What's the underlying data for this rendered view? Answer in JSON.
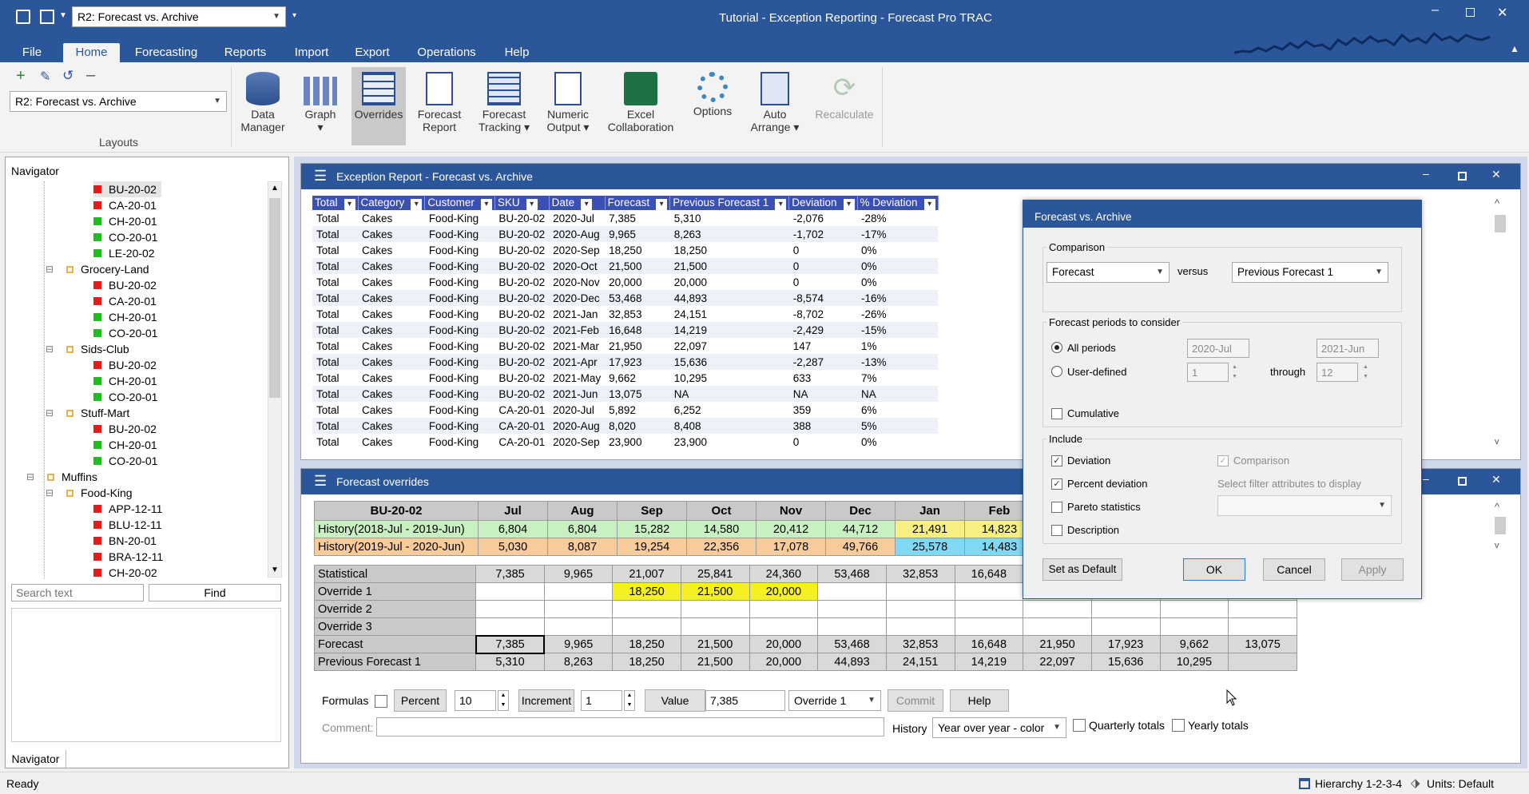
{
  "app": {
    "title": "Tutorial - Exception Reporting - Forecast Pro TRAC",
    "layout_select": "R2: Forecast vs. Archive"
  },
  "menu": [
    "File",
    "Home",
    "Forecasting",
    "Reports",
    "Import",
    "Export",
    "Operations",
    "Help"
  ],
  "ribbon": {
    "layouts_label": "Layouts",
    "layout_value": "R2: Forecast vs. Archive",
    "buttons": [
      {
        "l1": "Data",
        "l2": "Manager"
      },
      {
        "l1": "Graph",
        "l2": "▾"
      },
      {
        "l1": "Overrides",
        "l2": ""
      },
      {
        "l1": "Forecast",
        "l2": "Report"
      },
      {
        "l1": "Forecast",
        "l2": "Tracking ▾"
      },
      {
        "l1": "Numeric",
        "l2": "Output ▾"
      },
      {
        "l1": "Excel",
        "l2": "Collaboration"
      },
      {
        "l1": "Options",
        "l2": ""
      },
      {
        "l1": "Auto",
        "l2": "Arrange ▾"
      },
      {
        "l1": "Recalculate",
        "l2": ""
      }
    ]
  },
  "navigator": {
    "title": "Navigator",
    "search_placeholder": "Search text",
    "find": "Find",
    "tab": "Navigator",
    "items": [
      {
        "t": "BU-20-02",
        "lvl": 3,
        "c": "#e31b1b"
      },
      {
        "t": "CA-20-01",
        "lvl": 3,
        "c": "#e31b1b"
      },
      {
        "t": "CH-20-01",
        "lvl": 3,
        "c": "#22bb22"
      },
      {
        "t": "CO-20-01",
        "lvl": 3,
        "c": "#22bb22"
      },
      {
        "t": "LE-20-02",
        "lvl": 3,
        "c": "#22bb22"
      },
      {
        "t": "Grocery-Land",
        "lvl": 2,
        "c": "#e8b44a"
      },
      {
        "t": "BU-20-02",
        "lvl": 3,
        "c": "#e31b1b"
      },
      {
        "t": "CA-20-01",
        "lvl": 3,
        "c": "#e31b1b"
      },
      {
        "t": "CH-20-01",
        "lvl": 3,
        "c": "#22bb22"
      },
      {
        "t": "CO-20-01",
        "lvl": 3,
        "c": "#22bb22"
      },
      {
        "t": "Sids-Club",
        "lvl": 2,
        "c": "#e8b44a"
      },
      {
        "t": "BU-20-02",
        "lvl": 3,
        "c": "#e31b1b"
      },
      {
        "t": "CH-20-01",
        "lvl": 3,
        "c": "#22bb22"
      },
      {
        "t": "CO-20-01",
        "lvl": 3,
        "c": "#22bb22"
      },
      {
        "t": "Stuff-Mart",
        "lvl": 2,
        "c": "#e8b44a"
      },
      {
        "t": "BU-20-02",
        "lvl": 3,
        "c": "#e31b1b"
      },
      {
        "t": "CH-20-01",
        "lvl": 3,
        "c": "#22bb22"
      },
      {
        "t": "CO-20-01",
        "lvl": 3,
        "c": "#22bb22"
      },
      {
        "t": "Muffins",
        "lvl": 1,
        "c": "#e8b44a"
      },
      {
        "t": "Food-King",
        "lvl": 2,
        "c": "#e8b44a"
      },
      {
        "t": "APP-12-11",
        "lvl": 3,
        "c": "#e31b1b"
      },
      {
        "t": "BLU-12-11",
        "lvl": 3,
        "c": "#e31b1b"
      },
      {
        "t": "BN-20-01",
        "lvl": 3,
        "c": "#e31b1b"
      },
      {
        "t": "BRA-12-11",
        "lvl": 3,
        "c": "#e31b1b"
      },
      {
        "t": "CH-20-02",
        "lvl": 3,
        "c": "#e31b1b"
      }
    ]
  },
  "exception": {
    "title": "Exception Report - Forecast vs. Archive",
    "columns": [
      "Total",
      "Category",
      "Customer",
      "SKU",
      "Date",
      "Forecast",
      "Previous Forecast 1",
      "Deviation",
      "% Deviation"
    ],
    "rows": [
      [
        "Total",
        "Cakes",
        "Food-King",
        "BU-20-02",
        "2020-Jul",
        "7,385",
        "5,310",
        "-2,076",
        "-28%"
      ],
      [
        "Total",
        "Cakes",
        "Food-King",
        "BU-20-02",
        "2020-Aug",
        "9,965",
        "8,263",
        "-1,702",
        "-17%"
      ],
      [
        "Total",
        "Cakes",
        "Food-King",
        "BU-20-02",
        "2020-Sep",
        "18,250",
        "18,250",
        "0",
        "0%"
      ],
      [
        "Total",
        "Cakes",
        "Food-King",
        "BU-20-02",
        "2020-Oct",
        "21,500",
        "21,500",
        "0",
        "0%"
      ],
      [
        "Total",
        "Cakes",
        "Food-King",
        "BU-20-02",
        "2020-Nov",
        "20,000",
        "20,000",
        "0",
        "0%"
      ],
      [
        "Total",
        "Cakes",
        "Food-King",
        "BU-20-02",
        "2020-Dec",
        "53,468",
        "44,893",
        "-8,574",
        "-16%"
      ],
      [
        "Total",
        "Cakes",
        "Food-King",
        "BU-20-02",
        "2021-Jan",
        "32,853",
        "24,151",
        "-8,702",
        "-26%"
      ],
      [
        "Total",
        "Cakes",
        "Food-King",
        "BU-20-02",
        "2021-Feb",
        "16,648",
        "14,219",
        "-2,429",
        "-15%"
      ],
      [
        "Total",
        "Cakes",
        "Food-King",
        "BU-20-02",
        "2021-Mar",
        "21,950",
        "22,097",
        "147",
        "1%"
      ],
      [
        "Total",
        "Cakes",
        "Food-King",
        "BU-20-02",
        "2021-Apr",
        "17,923",
        "15,636",
        "-2,287",
        "-13%"
      ],
      [
        "Total",
        "Cakes",
        "Food-King",
        "BU-20-02",
        "2021-May",
        "9,662",
        "10,295",
        "633",
        "7%"
      ],
      [
        "Total",
        "Cakes",
        "Food-King",
        "BU-20-02",
        "2021-Jun",
        "13,075",
        "NA",
        "NA",
        "NA"
      ],
      [
        "Total",
        "Cakes",
        "Food-King",
        "CA-20-01",
        "2020-Jul",
        "5,892",
        "6,252",
        "359",
        "6%"
      ],
      [
        "Total",
        "Cakes",
        "Food-King",
        "CA-20-01",
        "2020-Aug",
        "8,020",
        "8,408",
        "388",
        "5%"
      ],
      [
        "Total",
        "Cakes",
        "Food-King",
        "CA-20-01",
        "2020-Sep",
        "23,900",
        "23,900",
        "0",
        "0%"
      ]
    ]
  },
  "overrides": {
    "title": "Forecast overrides",
    "item": "BU-20-02",
    "months": [
      "Jul",
      "Aug",
      "Sep",
      "Oct",
      "Nov",
      "Dec",
      "Jan",
      "Feb"
    ],
    "hist1_label": "History(2018-Jul - 2019-Jun)",
    "hist1": [
      "6,804",
      "6,804",
      "15,282",
      "14,580",
      "20,412",
      "44,712",
      "21,491",
      "14,823"
    ],
    "hist2_label": "History(2019-Jul - 2020-Jun)",
    "hist2": [
      "5,030",
      "8,087",
      "19,254",
      "22,356",
      "17,078",
      "49,766",
      "25,578",
      "14,483"
    ],
    "rows": [
      {
        "label": "Statistical",
        "vals": [
          "7,385",
          "9,965",
          "21,007",
          "25,841",
          "24,360",
          "53,468",
          "32,853",
          "16,648",
          "",
          "",
          "",
          "",
          ""
        ]
      },
      {
        "label": "Override 1",
        "vals": [
          "",
          "",
          "18,250",
          "21,500",
          "20,000",
          "",
          "",
          "",
          "",
          "",
          "",
          "",
          ""
        ]
      },
      {
        "label": "Override 2",
        "vals": [
          "",
          "",
          "",
          "",
          "",
          "",
          "",
          "",
          "",
          "",
          "",
          "",
          ""
        ]
      },
      {
        "label": "Override 3",
        "vals": [
          "",
          "",
          "",
          "",
          "",
          "",
          "",
          "",
          "",
          "",
          "",
          "",
          ""
        ]
      },
      {
        "label": "Forecast",
        "vals": [
          "7,385",
          "9,965",
          "18,250",
          "21,500",
          "20,000",
          "53,468",
          "32,853",
          "16,648",
          "21,950",
          "17,923",
          "9,662",
          "13,075",
          ""
        ]
      },
      {
        "label": "Previous Forecast 1",
        "vals": [
          "5,310",
          "8,263",
          "18,250",
          "21,500",
          "20,000",
          "44,893",
          "24,151",
          "14,219",
          "22,097",
          "15,636",
          "10,295",
          "",
          ""
        ]
      }
    ],
    "formulas_label": "Formulas",
    "percent_label": "Percent",
    "percent_value": "10",
    "increment_label": "Increment",
    "increment_value": "1",
    "value_label": "Value",
    "value_value": "7,385",
    "override_select": "Override 1",
    "commit": "Commit",
    "help": "Help",
    "comment_label": "Comment:",
    "history_label": "History",
    "history_select": "Year over year - color",
    "quarterly": "Quarterly totals",
    "yearly": "Yearly totals"
  },
  "dialog": {
    "title": "Forecast vs. Archive",
    "comparison_label": "Comparison",
    "comp_left": "Forecast",
    "versus": "versus",
    "comp_right": "Previous Forecast 1",
    "periods_label": "Forecast periods to consider",
    "all_periods": "All periods",
    "user_defined": "User-defined",
    "from_date": "2020-Jul",
    "to_date": "2021-Jun",
    "from_num": "1",
    "to_num": "12",
    "through": "through",
    "cumulative": "Cumulative",
    "include_label": "Include",
    "deviation": "Deviation",
    "percent_deviation": "Percent deviation",
    "pareto": "Pareto statistics",
    "description": "Description",
    "comparison_chk": "Comparison",
    "filter_label": "Select filter attributes to display",
    "set_default": "Set as Default",
    "ok": "OK",
    "cancel": "Cancel",
    "apply": "Apply"
  },
  "status": {
    "ready": "Ready",
    "hierarchy": "Hierarchy 1-2-3-4",
    "units": "Units: Default"
  }
}
